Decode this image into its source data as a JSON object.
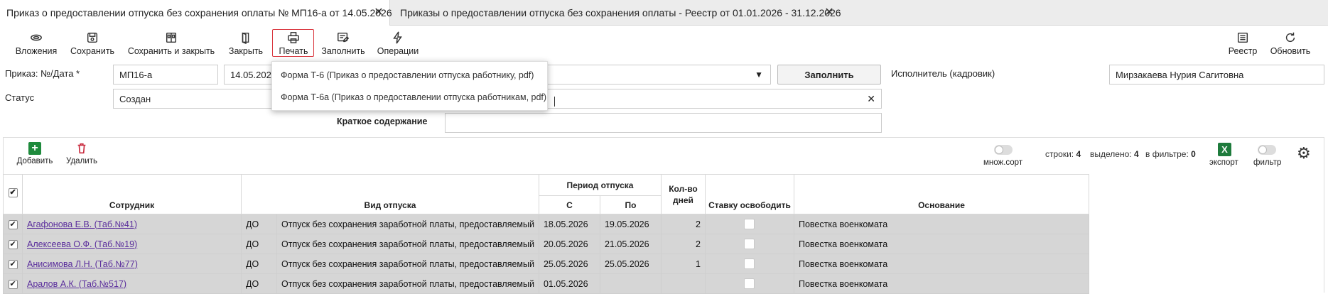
{
  "tabs": [
    {
      "title": "Приказ о предоставлении отпуска без сохранения оплаты № МП16-а от 14.05.2026",
      "active": true
    },
    {
      "title": "Приказы о предоставлении отпуска без сохранения оплаты - Реестр от 01.01.2026 - 31.12.2026",
      "active": false
    }
  ],
  "toolbar": {
    "attachments": "Вложения",
    "save": "Сохранить",
    "save_close": "Сохранить и закрыть",
    "close": "Закрыть",
    "print": "Печать",
    "fill": "Заполнить",
    "operations": "Операции",
    "registry": "Реестр",
    "refresh": "Обновить"
  },
  "print_menu": [
    "Форма Т-6 (Приказ о предоставлении отпуска работнику, pdf)",
    "Форма Т-6а (Приказ о предоставлении отпуска работникам, pdf)"
  ],
  "form": {
    "order_label": "Приказ: №/Дата *",
    "order_number": "МП16-а",
    "order_date": "14.05.2026",
    "fill_button": "Заполнить",
    "executor_label": "Исполнитель (кадровик)",
    "executor_value": "Мирзакаева Нурия Сагитовна",
    "status_label": "Статус",
    "status_value": "Создан",
    "summary_label": "Краткое содержание",
    "summary_value": ""
  },
  "grid_toolbar": {
    "add": "Добавить",
    "delete": "Удалить",
    "multisort": "множ.сорт",
    "rows_label": "строки:",
    "rows_value": "4",
    "selected_label": "выделено:",
    "selected_value": "4",
    "in_filter_label": "в фильтре:",
    "in_filter_value": "0",
    "export": "экспорт",
    "filter": "фильтр"
  },
  "table": {
    "headers": {
      "employee": "Сотрудник",
      "leave_type": "Вид отпуска",
      "period": "Период отпуска",
      "from": "С",
      "to": "По",
      "days": "Кол-во дней",
      "release_rate": "Ставку освободить",
      "basis": "Основание"
    },
    "rows": [
      {
        "employee": "Агафонова Е.В. (Таб.№41)",
        "code": "ДО",
        "type": "Отпуск без сохранения заработной платы, предоставляемый",
        "from": "18.05.2026",
        "to": "19.05.2026",
        "days": "2",
        "basis": "Повестка военкомата"
      },
      {
        "employee": "Алексеева О.Ф. (Таб.№19)",
        "code": "ДО",
        "type": "Отпуск без сохранения заработной платы, предоставляемый",
        "from": "20.05.2026",
        "to": "21.05.2026",
        "days": "2",
        "basis": "Повестка военкомата"
      },
      {
        "employee": "Анисимова Л.Н. (Таб.№77)",
        "code": "ДО",
        "type": "Отпуск без сохранения заработной платы, предоставляемый",
        "from": "25.05.2026",
        "to": "25.05.2026",
        "days": "1",
        "basis": "Повестка военкомата"
      },
      {
        "employee": "Аралов А.К. (Таб.№517)",
        "code": "ДО",
        "type": "Отпуск без сохранения заработной платы, предоставляемый",
        "from": "01.05.2026",
        "to": "",
        "days": "",
        "basis": "Повестка военкомата"
      }
    ]
  },
  "colors": {
    "accent_red": "#d9363e",
    "export_green": "#1e7b3c",
    "add_green": "#1e8a3c",
    "delete_red": "#c8283c",
    "link": "#5a2d9c"
  }
}
